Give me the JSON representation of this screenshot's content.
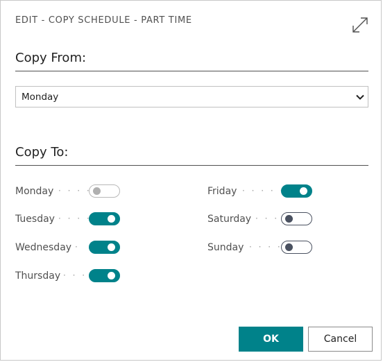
{
  "dialog": {
    "title": "EDIT - COPY SCHEDULE - PART TIME",
    "expand_icon": "expand-diagonal-icon"
  },
  "copy_from": {
    "header": "Copy From:",
    "selected_value": "Monday",
    "chevron_icon": "chevron-down-icon"
  },
  "copy_to": {
    "header": "Copy To:",
    "days": [
      {
        "label": "Monday",
        "dots": "· · · ·",
        "state": "disabled"
      },
      {
        "label": "Tuesday",
        "dots": "· · · ·",
        "state": "on"
      },
      {
        "label": "Wednesday",
        "dots": "·",
        "state": "on"
      },
      {
        "label": "Thursday",
        "dots": "· · ·",
        "state": "on"
      },
      {
        "label": "Friday",
        "dots": "· · · · ·",
        "state": "on"
      },
      {
        "label": "Saturday",
        "dots": "· · ·",
        "state": "off"
      },
      {
        "label": "Sunday",
        "dots": "· · · ·",
        "state": "off"
      }
    ]
  },
  "buttons": {
    "ok_label": "OK",
    "cancel_label": "Cancel"
  },
  "colors": {
    "accent": "#00828a",
    "toggle_off": "#4a5160",
    "toggle_disabled": "#b0b0b0"
  }
}
